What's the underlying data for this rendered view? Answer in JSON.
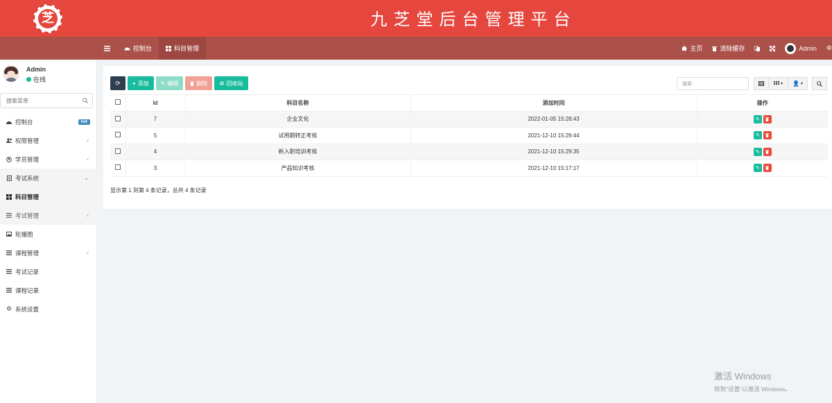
{
  "header": {
    "logo_char": "芝",
    "title": "九芝堂后台管理平台"
  },
  "navbar": {
    "toggle_icon": "menu-icon",
    "tabs": [
      {
        "label": "控制台",
        "icon": "dashboard-icon"
      },
      {
        "label": "科目管理",
        "icon": "grid-icon"
      }
    ],
    "right": {
      "home": "主页",
      "clear_cache": "清除缓存",
      "user": "Admin"
    }
  },
  "sidebar": {
    "user": {
      "name": "Admin",
      "status": "在线"
    },
    "search_placeholder": "搜索菜单",
    "items": [
      {
        "label": "控制台",
        "icon": "dashboard-icon",
        "badge": "hot"
      },
      {
        "label": "权限管理",
        "icon": "users-icon"
      },
      {
        "label": "学员管理",
        "icon": "user-circle-icon"
      },
      {
        "label": "考试系统",
        "icon": "file-icon"
      },
      {
        "label": "科目管理",
        "icon": "grid-icon"
      },
      {
        "label": "考试管理",
        "icon": "list-icon"
      },
      {
        "label": "轮播图",
        "icon": "image-icon"
      },
      {
        "label": "课程管理",
        "icon": "list-icon"
      },
      {
        "label": "考试记录",
        "icon": "list-icon"
      },
      {
        "label": "课程记录",
        "icon": "list-icon"
      },
      {
        "label": "系统设置",
        "icon": "gear-icon"
      }
    ]
  },
  "toolbar": {
    "add": "添加",
    "edit": "编辑",
    "delete": "删除",
    "recycle": "回收站",
    "search_placeholder": "搜索"
  },
  "table": {
    "columns": [
      "Id",
      "科目名称",
      "添加时间",
      "操作"
    ],
    "rows": [
      {
        "id": "7",
        "name": "企业文化",
        "time": "2022-01-05 15:28:43"
      },
      {
        "id": "5",
        "name": "试用期转正考核",
        "time": "2021-12-10 15:29:44"
      },
      {
        "id": "4",
        "name": "新入职培训考核",
        "time": "2021-12-10 15:29:35"
      },
      {
        "id": "3",
        "name": "产品知识考核",
        "time": "2021-12-10 15:17:17"
      }
    ],
    "summary": "显示第 1 到第 4 条记录，总共 4 条记录"
  },
  "watermark": {
    "line1": "激活 Windows",
    "line2": "转到\"设置\"以激活 Windows。"
  }
}
